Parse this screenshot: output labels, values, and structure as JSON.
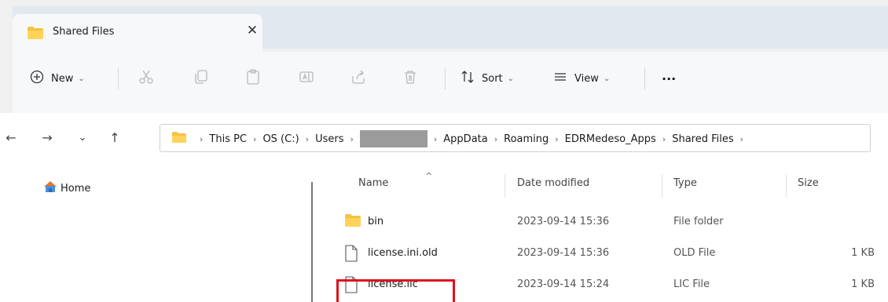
{
  "window": {
    "tab_title": "Shared Files",
    "tab_close": "✕"
  },
  "toolbar": {
    "new_label": "New",
    "sort_label": "Sort",
    "view_label": "View",
    "more_label": "···",
    "caret": "⌄"
  },
  "nav": {
    "back": "←",
    "forward": "→",
    "recent": "⌄",
    "up": "↑"
  },
  "address": {
    "separator": "›",
    "segments": [
      "This PC",
      "OS (C:)",
      "Users",
      "AppData",
      "Roaming",
      "EDRMedeso_Apps",
      "Shared Files"
    ]
  },
  "sidebar": {
    "home_label": "Home"
  },
  "columns": {
    "name": "Name",
    "date": "Date modified",
    "type": "Type",
    "size": "Size",
    "sort_indicator": "^"
  },
  "files": [
    {
      "name": "bin",
      "date": "2023-09-14 15:36",
      "type": "File folder",
      "size": "",
      "icon": "folder-icon"
    },
    {
      "name": "license.ini.old",
      "date": "2023-09-14 15:36",
      "type": "OLD File",
      "size": "1 KB",
      "icon": "file-icon"
    },
    {
      "name": "license.lic",
      "date": "2023-09-14 15:24",
      "type": "LIC File",
      "size": "1 KB",
      "icon": "file-icon"
    }
  ],
  "colors": {
    "highlight": "#e0101f",
    "folder": "#f4c243",
    "tab_strip": "#e2e8ef"
  }
}
